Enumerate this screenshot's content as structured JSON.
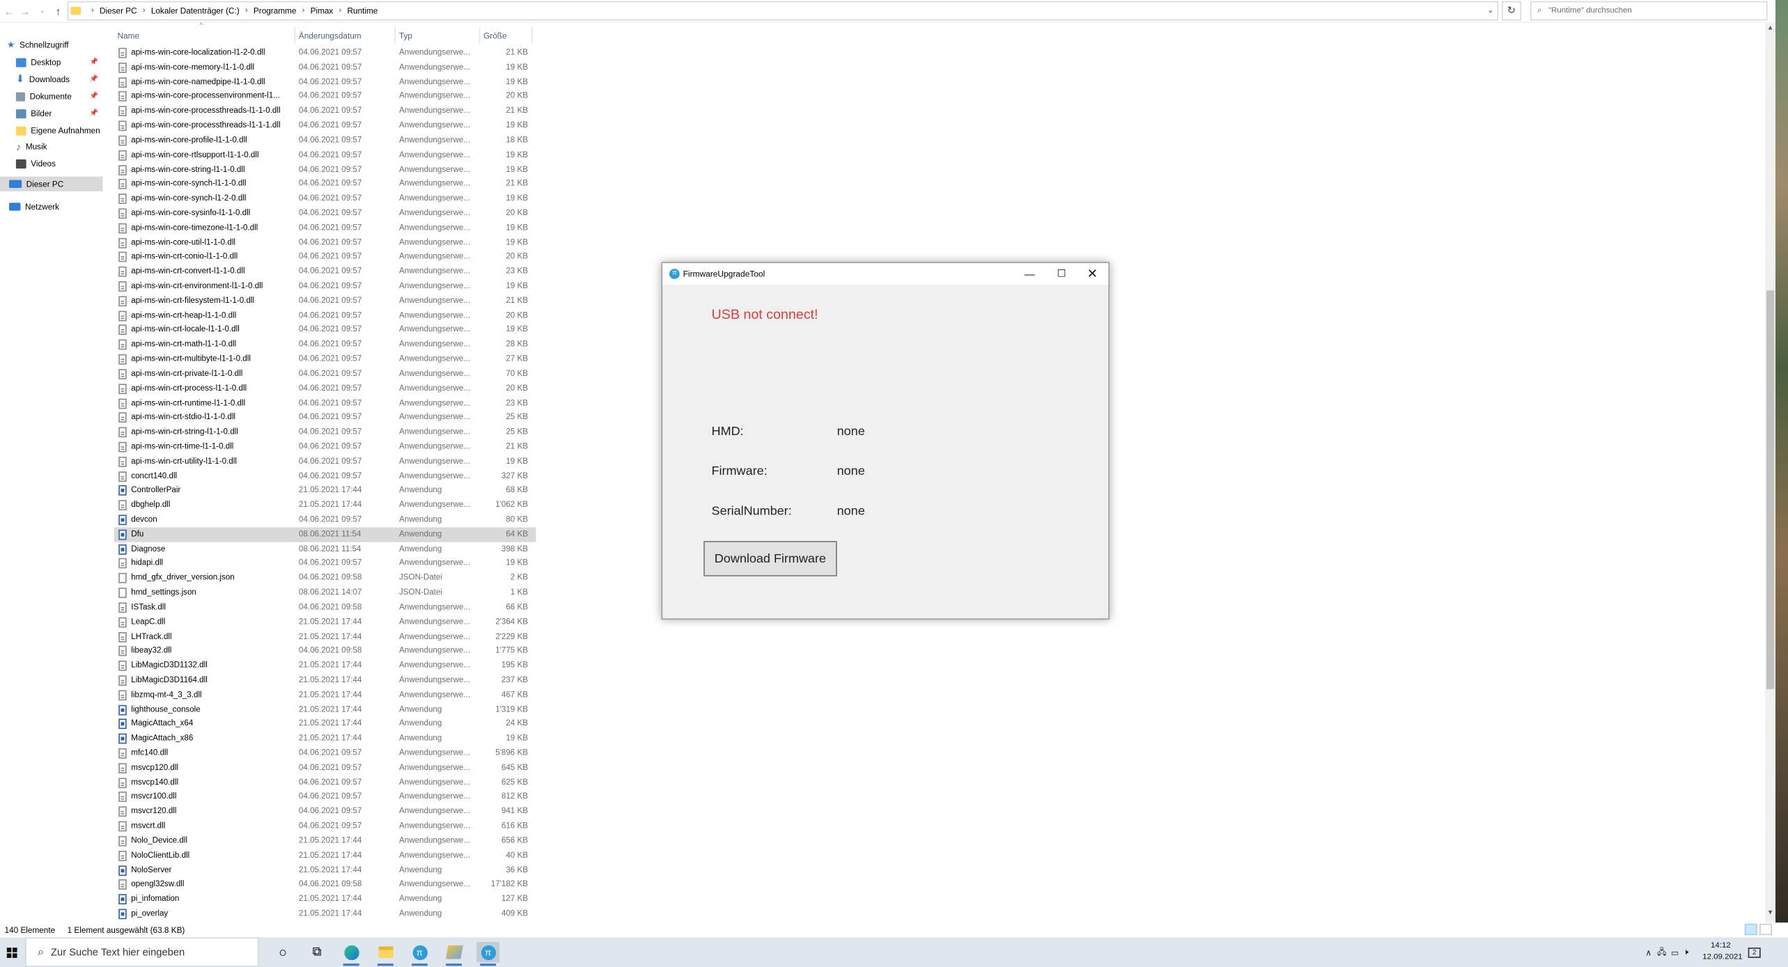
{
  "address_bar": {
    "breadcrumbs": [
      "Dieser PC",
      "Lokaler Datenträger (C:)",
      "Programme",
      "Pimax",
      "Runtime"
    ],
    "search_placeholder": "\"Runtime\" durchsuchen"
  },
  "nav_pane": {
    "items": [
      {
        "label": "Schnellzugriff",
        "icon": "star-icon",
        "color": "#2f7fd6",
        "pinned": false
      },
      {
        "label": "Desktop",
        "icon": "desktop-folder-icon",
        "color": "#3c8ad8",
        "pinned": true
      },
      {
        "label": "Downloads",
        "icon": "download-arrow-icon",
        "color": "#2f7fd6",
        "pinned": true
      },
      {
        "label": "Dokumente",
        "icon": "documents-icon",
        "color": "#8a9aab",
        "pinned": true
      },
      {
        "label": "Bilder",
        "icon": "pictures-icon",
        "color": "#5d8fb5",
        "pinned": true
      },
      {
        "label": "Eigene Aufnahmen",
        "icon": "folder-icon",
        "color": "#ffd45e",
        "pinned": false
      },
      {
        "label": "Musik",
        "icon": "music-icon",
        "color": "#2f6fc0",
        "pinned": false
      },
      {
        "label": "Videos",
        "icon": "video-icon",
        "color": "#4a4a4a",
        "pinned": false
      },
      {
        "label": "Dieser PC",
        "icon": "computer-icon",
        "color": "#2f7fd6",
        "pinned": false
      },
      {
        "label": "Netzwerk",
        "icon": "network-icon",
        "color": "#2f7fd6",
        "pinned": false
      }
    ]
  },
  "columns": {
    "name": "Name",
    "date": "Änderungsdatum",
    "type": "Typ",
    "size": "Größe"
  },
  "files": [
    {
      "name": "api-ms-win-core-localization-l1-2-0.dll",
      "date": "04.06.2021 09:57",
      "type": "Anwendungserwe...",
      "size": "21 KB",
      "kind": "dll"
    },
    {
      "name": "api-ms-win-core-memory-l1-1-0.dll",
      "date": "04.06.2021 09:57",
      "type": "Anwendungserwe...",
      "size": "19 KB",
      "kind": "dll"
    },
    {
      "name": "api-ms-win-core-namedpipe-l1-1-0.dll",
      "date": "04.06.2021 09:57",
      "type": "Anwendungserwe...",
      "size": "19 KB",
      "kind": "dll"
    },
    {
      "name": "api-ms-win-core-processenvironment-l1...",
      "date": "04.06.2021 09:57",
      "type": "Anwendungserwe...",
      "size": "20 KB",
      "kind": "dll"
    },
    {
      "name": "api-ms-win-core-processthreads-l1-1-0.dll",
      "date": "04.06.2021 09:57",
      "type": "Anwendungserwe...",
      "size": "21 KB",
      "kind": "dll"
    },
    {
      "name": "api-ms-win-core-processthreads-l1-1-1.dll",
      "date": "04.06.2021 09:57",
      "type": "Anwendungserwe...",
      "size": "19 KB",
      "kind": "dll"
    },
    {
      "name": "api-ms-win-core-profile-l1-1-0.dll",
      "date": "04.06.2021 09:57",
      "type": "Anwendungserwe...",
      "size": "18 KB",
      "kind": "dll"
    },
    {
      "name": "api-ms-win-core-rtlsupport-l1-1-0.dll",
      "date": "04.06.2021 09:57",
      "type": "Anwendungserwe...",
      "size": "19 KB",
      "kind": "dll"
    },
    {
      "name": "api-ms-win-core-string-l1-1-0.dll",
      "date": "04.06.2021 09:57",
      "type": "Anwendungserwe...",
      "size": "19 KB",
      "kind": "dll"
    },
    {
      "name": "api-ms-win-core-synch-l1-1-0.dll",
      "date": "04.06.2021 09:57",
      "type": "Anwendungserwe...",
      "size": "21 KB",
      "kind": "dll"
    },
    {
      "name": "api-ms-win-core-synch-l1-2-0.dll",
      "date": "04.06.2021 09:57",
      "type": "Anwendungserwe...",
      "size": "19 KB",
      "kind": "dll"
    },
    {
      "name": "api-ms-win-core-sysinfo-l1-1-0.dll",
      "date": "04.06.2021 09:57",
      "type": "Anwendungserwe...",
      "size": "20 KB",
      "kind": "dll"
    },
    {
      "name": "api-ms-win-core-timezone-l1-1-0.dll",
      "date": "04.06.2021 09:57",
      "type": "Anwendungserwe...",
      "size": "19 KB",
      "kind": "dll"
    },
    {
      "name": "api-ms-win-core-util-l1-1-0.dll",
      "date": "04.06.2021 09:57",
      "type": "Anwendungserwe...",
      "size": "19 KB",
      "kind": "dll"
    },
    {
      "name": "api-ms-win-crt-conio-l1-1-0.dll",
      "date": "04.06.2021 09:57",
      "type": "Anwendungserwe...",
      "size": "20 KB",
      "kind": "dll"
    },
    {
      "name": "api-ms-win-crt-convert-l1-1-0.dll",
      "date": "04.06.2021 09:57",
      "type": "Anwendungserwe...",
      "size": "23 KB",
      "kind": "dll"
    },
    {
      "name": "api-ms-win-crt-environment-l1-1-0.dll",
      "date": "04.06.2021 09:57",
      "type": "Anwendungserwe...",
      "size": "19 KB",
      "kind": "dll"
    },
    {
      "name": "api-ms-win-crt-filesystem-l1-1-0.dll",
      "date": "04.06.2021 09:57",
      "type": "Anwendungserwe...",
      "size": "21 KB",
      "kind": "dll"
    },
    {
      "name": "api-ms-win-crt-heap-l1-1-0.dll",
      "date": "04.06.2021 09:57",
      "type": "Anwendungserwe...",
      "size": "20 KB",
      "kind": "dll"
    },
    {
      "name": "api-ms-win-crt-locale-l1-1-0.dll",
      "date": "04.06.2021 09:57",
      "type": "Anwendungserwe...",
      "size": "19 KB",
      "kind": "dll"
    },
    {
      "name": "api-ms-win-crt-math-l1-1-0.dll",
      "date": "04.06.2021 09:57",
      "type": "Anwendungserwe...",
      "size": "28 KB",
      "kind": "dll"
    },
    {
      "name": "api-ms-win-crt-multibyte-l1-1-0.dll",
      "date": "04.06.2021 09:57",
      "type": "Anwendungserwe...",
      "size": "27 KB",
      "kind": "dll"
    },
    {
      "name": "api-ms-win-crt-private-l1-1-0.dll",
      "date": "04.06.2021 09:57",
      "type": "Anwendungserwe...",
      "size": "70 KB",
      "kind": "dll"
    },
    {
      "name": "api-ms-win-crt-process-l1-1-0.dll",
      "date": "04.06.2021 09:57",
      "type": "Anwendungserwe...",
      "size": "20 KB",
      "kind": "dll"
    },
    {
      "name": "api-ms-win-crt-runtime-l1-1-0.dll",
      "date": "04.06.2021 09:57",
      "type": "Anwendungserwe...",
      "size": "23 KB",
      "kind": "dll"
    },
    {
      "name": "api-ms-win-crt-stdio-l1-1-0.dll",
      "date": "04.06.2021 09:57",
      "type": "Anwendungserwe...",
      "size": "25 KB",
      "kind": "dll"
    },
    {
      "name": "api-ms-win-crt-string-l1-1-0.dll",
      "date": "04.06.2021 09:57",
      "type": "Anwendungserwe...",
      "size": "25 KB",
      "kind": "dll"
    },
    {
      "name": "api-ms-win-crt-time-l1-1-0.dll",
      "date": "04.06.2021 09:57",
      "type": "Anwendungserwe...",
      "size": "21 KB",
      "kind": "dll"
    },
    {
      "name": "api-ms-win-crt-utility-l1-1-0.dll",
      "date": "04.06.2021 09:57",
      "type": "Anwendungserwe...",
      "size": "19 KB",
      "kind": "dll"
    },
    {
      "name": "concrt140.dll",
      "date": "04.06.2021 09:57",
      "type": "Anwendungserwe...",
      "size": "327 KB",
      "kind": "dll"
    },
    {
      "name": "ControllerPair",
      "date": "21.05.2021 17:44",
      "type": "Anwendung",
      "size": "68 KB",
      "kind": "exe"
    },
    {
      "name": "dbghelp.dll",
      "date": "21.05.2021 17:44",
      "type": "Anwendungserwe...",
      "size": "1'062 KB",
      "kind": "dll"
    },
    {
      "name": "devcon",
      "date": "04.06.2021 09:57",
      "type": "Anwendung",
      "size": "80 KB",
      "kind": "exe"
    },
    {
      "name": "Dfu",
      "date": "08.06.2021 11:54",
      "type": "Anwendung",
      "size": "64 KB",
      "kind": "exe",
      "selected": true
    },
    {
      "name": "Diagnose",
      "date": "08.06.2021 11:54",
      "type": "Anwendung",
      "size": "398 KB",
      "kind": "exe"
    },
    {
      "name": "hidapi.dll",
      "date": "04.06.2021 09:57",
      "type": "Anwendungserwe...",
      "size": "19 KB",
      "kind": "dll"
    },
    {
      "name": "hmd_gfx_driver_version.json",
      "date": "04.06.2021 09:58",
      "type": "JSON-Datei",
      "size": "2 KB",
      "kind": "file"
    },
    {
      "name": "hmd_settings.json",
      "date": "08.06.2021 14:07",
      "type": "JSON-Datei",
      "size": "1 KB",
      "kind": "file"
    },
    {
      "name": "ISTask.dll",
      "date": "04.06.2021 09:58",
      "type": "Anwendungserwe...",
      "size": "66 KB",
      "kind": "dll"
    },
    {
      "name": "LeapC.dll",
      "date": "21.05.2021 17:44",
      "type": "Anwendungserwe...",
      "size": "2'364 KB",
      "kind": "dll"
    },
    {
      "name": "LHTrack.dll",
      "date": "21.05.2021 17:44",
      "type": "Anwendungserwe...",
      "size": "2'229 KB",
      "kind": "dll"
    },
    {
      "name": "libeay32.dll",
      "date": "04.06.2021 09:58",
      "type": "Anwendungserwe...",
      "size": "1'775 KB",
      "kind": "dll"
    },
    {
      "name": "LibMagicD3D1132.dll",
      "date": "21.05.2021 17:44",
      "type": "Anwendungserwe...",
      "size": "195 KB",
      "kind": "dll"
    },
    {
      "name": "LibMagicD3D1164.dll",
      "date": "21.05.2021 17:44",
      "type": "Anwendungserwe...",
      "size": "237 KB",
      "kind": "dll"
    },
    {
      "name": "libzmq-mt-4_3_3.dll",
      "date": "21.05.2021 17:44",
      "type": "Anwendungserwe...",
      "size": "467 KB",
      "kind": "dll"
    },
    {
      "name": "lighthouse_console",
      "date": "21.05.2021 17:44",
      "type": "Anwendung",
      "size": "1'319 KB",
      "kind": "exe"
    },
    {
      "name": "MagicAttach_x64",
      "date": "21.05.2021 17:44",
      "type": "Anwendung",
      "size": "24 KB",
      "kind": "exe"
    },
    {
      "name": "MagicAttach_x86",
      "date": "21.05.2021 17:44",
      "type": "Anwendung",
      "size": "19 KB",
      "kind": "exe"
    },
    {
      "name": "mfc140.dll",
      "date": "04.06.2021 09:57",
      "type": "Anwendungserwe...",
      "size": "5'896 KB",
      "kind": "dll"
    },
    {
      "name": "msvcp120.dll",
      "date": "04.06.2021 09:57",
      "type": "Anwendungserwe...",
      "size": "645 KB",
      "kind": "dll"
    },
    {
      "name": "msvcp140.dll",
      "date": "04.06.2021 09:57",
      "type": "Anwendungserwe...",
      "size": "625 KB",
      "kind": "dll"
    },
    {
      "name": "msvcr100.dll",
      "date": "04.06.2021 09:57",
      "type": "Anwendungserwe...",
      "size": "812 KB",
      "kind": "dll"
    },
    {
      "name": "msvcr120.dll",
      "date": "04.06.2021 09:57",
      "type": "Anwendungserwe...",
      "size": "941 KB",
      "kind": "dll"
    },
    {
      "name": "msvcrt.dll",
      "date": "04.06.2021 09:57",
      "type": "Anwendungserwe...",
      "size": "616 KB",
      "kind": "dll"
    },
    {
      "name": "Nolo_Device.dll",
      "date": "21.05.2021 17:44",
      "type": "Anwendungserwe...",
      "size": "656 KB",
      "kind": "dll"
    },
    {
      "name": "NoloClientLib.dll",
      "date": "21.05.2021 17:44",
      "type": "Anwendungserwe...",
      "size": "40 KB",
      "kind": "dll"
    },
    {
      "name": "NoloServer",
      "date": "21.05.2021 17:44",
      "type": "Anwendung",
      "size": "36 KB",
      "kind": "exe"
    },
    {
      "name": "opengl32sw.dll",
      "date": "04.06.2021 09:58",
      "type": "Anwendungserwe...",
      "size": "17'182 KB",
      "kind": "dll"
    },
    {
      "name": "pi_infomation",
      "date": "21.05.2021 17:44",
      "type": "Anwendung",
      "size": "127 KB",
      "kind": "exe"
    },
    {
      "name": "pi_overlay",
      "date": "21.05.2021 17:44",
      "type": "Anwendung",
      "size": "409 KB",
      "kind": "exe"
    }
  ],
  "status_bar": {
    "count": "140 Elemente",
    "selection": "1 Element ausgewählt (63.8 KB)"
  },
  "dialog": {
    "title": "FirmwareUpgradeTool",
    "usb_message": "USB not connect!",
    "usb_color": "#e03a3a",
    "fields": [
      {
        "label": "HMD:",
        "value": "none"
      },
      {
        "label": "Firmware:",
        "value": "none"
      },
      {
        "label": "SerialNumber:",
        "value": "none"
      }
    ],
    "download_button": "Download Firmware"
  },
  "taskbar": {
    "search_placeholder": "Zur Suche Text hier eingeben",
    "time": "14:12",
    "date": "12.09.2021",
    "notification_count": "2"
  }
}
